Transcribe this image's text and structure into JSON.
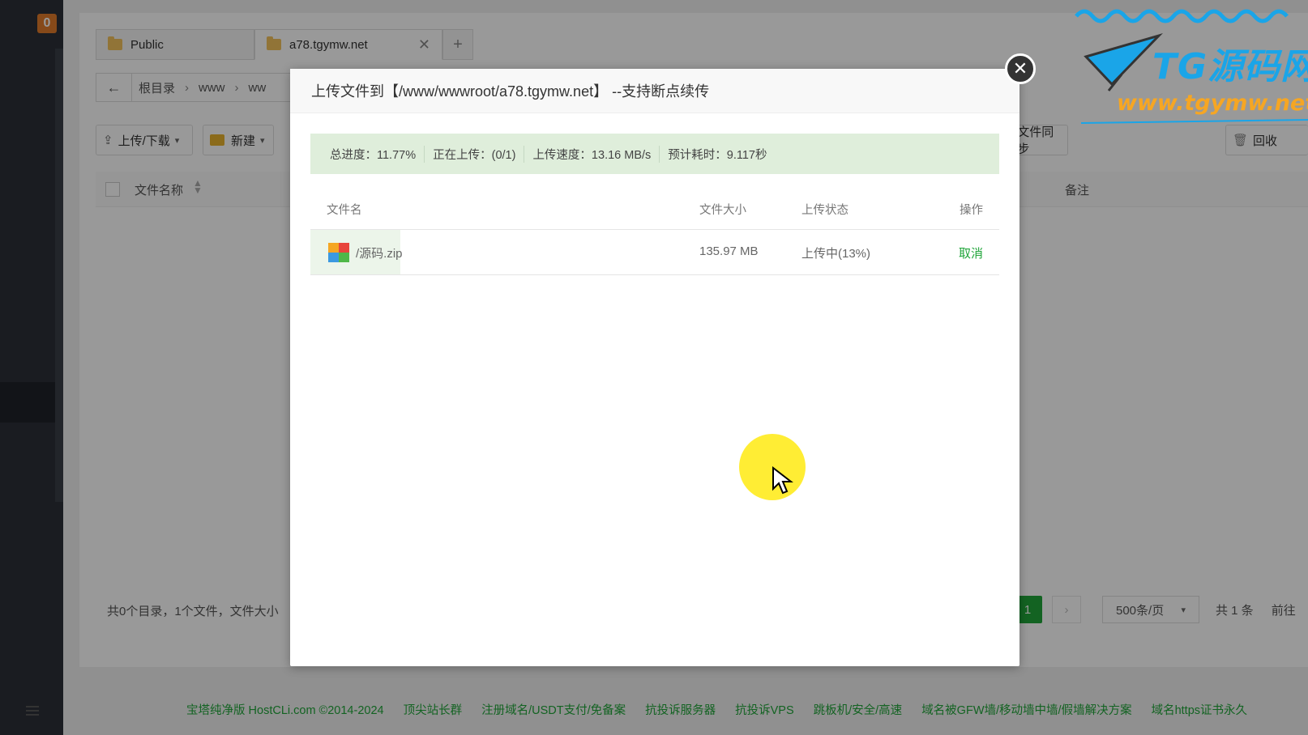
{
  "sidebar": {
    "badge": "0"
  },
  "tabs": [
    {
      "label": "Public"
    },
    {
      "label": "a78.tgymw.net",
      "close": "✕"
    },
    {
      "label": "+"
    }
  ],
  "path": {
    "back": "←",
    "crumbs": [
      "根目录",
      "www",
      "ww"
    ]
  },
  "toolbar": {
    "upload_label": "上传/下载",
    "new_label": "新建",
    "sync_label": "文件同步",
    "recycle_label": "回收"
  },
  "file_table": {
    "col_name": "文件名称",
    "col_remark": "备注",
    "summary": "共0个目录，1个文件，文件大小"
  },
  "pagination": {
    "current_page": "1",
    "next": "›",
    "page_size": "500条/页",
    "total": "共 1 条",
    "goto": "前往"
  },
  "footer": {
    "links": [
      "宝塔纯净版 HostCLi.com ©2014-2024",
      "顶尖站长群",
      "注册域名/USDT支付/免备案",
      "抗投诉服务器",
      "抗投诉VPS",
      "跳板机/安全/高速",
      "域名被GFW墙/移动墙中墙/假墙解决方案",
      "域名https证书永久"
    ]
  },
  "watermark": {
    "brand": "TG源码网",
    "url": "www.tgymw.net"
  },
  "modal": {
    "title": "上传文件到【/www/wwwroot/a78.tgymw.net】 --支持断点续传",
    "close": "✕",
    "progress": {
      "total": "总进度：11.77%",
      "uploading": "正在上传：(0/1)",
      "speed": "上传速度：13.16 MB/s",
      "eta": "预计耗时：9.117秒"
    },
    "table": {
      "headers": {
        "name": "文件名",
        "size": "文件大小",
        "status": "上传状态",
        "op": "操作"
      },
      "rows": [
        {
          "name": "/源码.zip",
          "size": "135.97 MB",
          "status": "上传中(13%)",
          "op": "取消",
          "progress_pct": 13
        }
      ]
    }
  },
  "colors": {
    "accent": "#20a53a",
    "progress_bg": "#dfeedb",
    "badge": "#e07a2a"
  }
}
